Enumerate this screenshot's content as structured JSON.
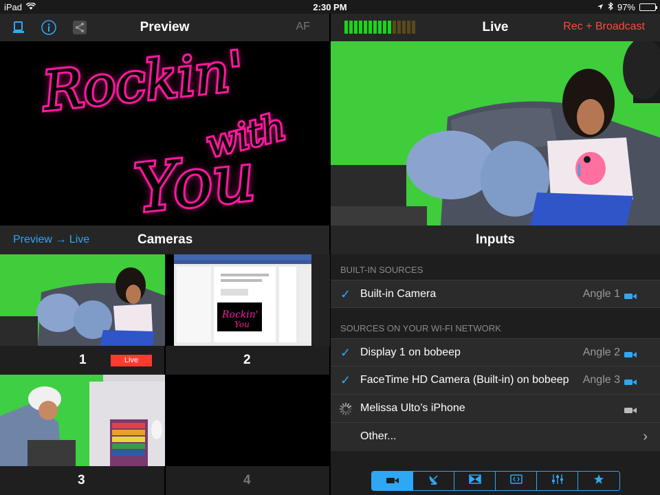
{
  "status": {
    "device": "iPad",
    "time": "2:30 PM",
    "battery": "97%",
    "battery_level": 0.97
  },
  "preview_bar": {
    "title": "Preview",
    "af_label": "AF"
  },
  "live_bar": {
    "title": "Live",
    "rec_label": "Rec + Broadcast",
    "meter_level": 10,
    "meter_total": 15
  },
  "preview_graphic": {
    "line1": "Rockin'",
    "line2": "with",
    "line3": "You"
  },
  "cameras": {
    "link": "Preview → Live",
    "title": "Cameras",
    "tiles": [
      {
        "number": "1",
        "badge": "Live"
      },
      {
        "number": "2",
        "badge": ""
      },
      {
        "number": "3",
        "badge": ""
      },
      {
        "number": "4",
        "badge": ""
      }
    ]
  },
  "inputs": {
    "title": "Inputs",
    "builtin_header": "BUILT-IN SOURCES",
    "wifi_header": "SOURCES ON YOUR WI-FI NETWORK",
    "rows": [
      {
        "label": "Built-in Camera",
        "angle": "Angle 1",
        "checked": true
      },
      {
        "label": "Display 1 on bobeep",
        "angle": "Angle 2",
        "checked": true
      },
      {
        "label": "FaceTime HD Camera (Built-in) on bobeep",
        "angle": "Angle 3",
        "checked": true
      },
      {
        "label": "Melissa Ulto’s iPhone",
        "angle": "",
        "checked": false
      },
      {
        "label": "Other...",
        "angle": "",
        "checked": false
      }
    ],
    "check_symbol": "✓",
    "chevron": "›"
  },
  "colors": {
    "accent": "#2ea8f5",
    "record": "#ff4a3b",
    "meter_on": "#19d619",
    "meter_off": "#5a4a1a",
    "neon": "#ff1aa0"
  },
  "icons": [
    "layout-icon",
    "info-icon",
    "share-icon",
    "video-camera-icon",
    "satellite-dish-icon",
    "transition-icon",
    "graphics-icon",
    "mixer-icon",
    "star-icon"
  ]
}
